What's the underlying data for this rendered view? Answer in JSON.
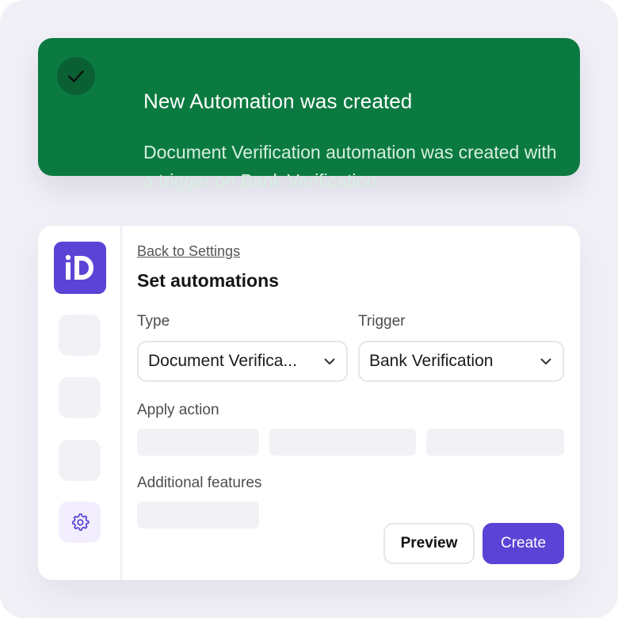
{
  "toast": {
    "title": "New Automation was created",
    "message_line1": "Document Verification automation was created with",
    "message_line2": "a trigger on Bank Verification.",
    "icon": "check-icon",
    "color": "#0b7a40"
  },
  "sidebar": {
    "logo_text": "iD",
    "logo_color": "#5b43d6",
    "settings_icon": "gear-icon"
  },
  "page": {
    "back_link": "Back to Settings",
    "title": "Set automations"
  },
  "form": {
    "type_label": "Type",
    "type_value": "Document Verifica...",
    "trigger_label": "Trigger",
    "trigger_value": "Bank Verification",
    "apply_action_label": "Apply action",
    "additional_features_label": "Additional features"
  },
  "actions": {
    "preview_label": "Preview",
    "create_label": "Create"
  }
}
